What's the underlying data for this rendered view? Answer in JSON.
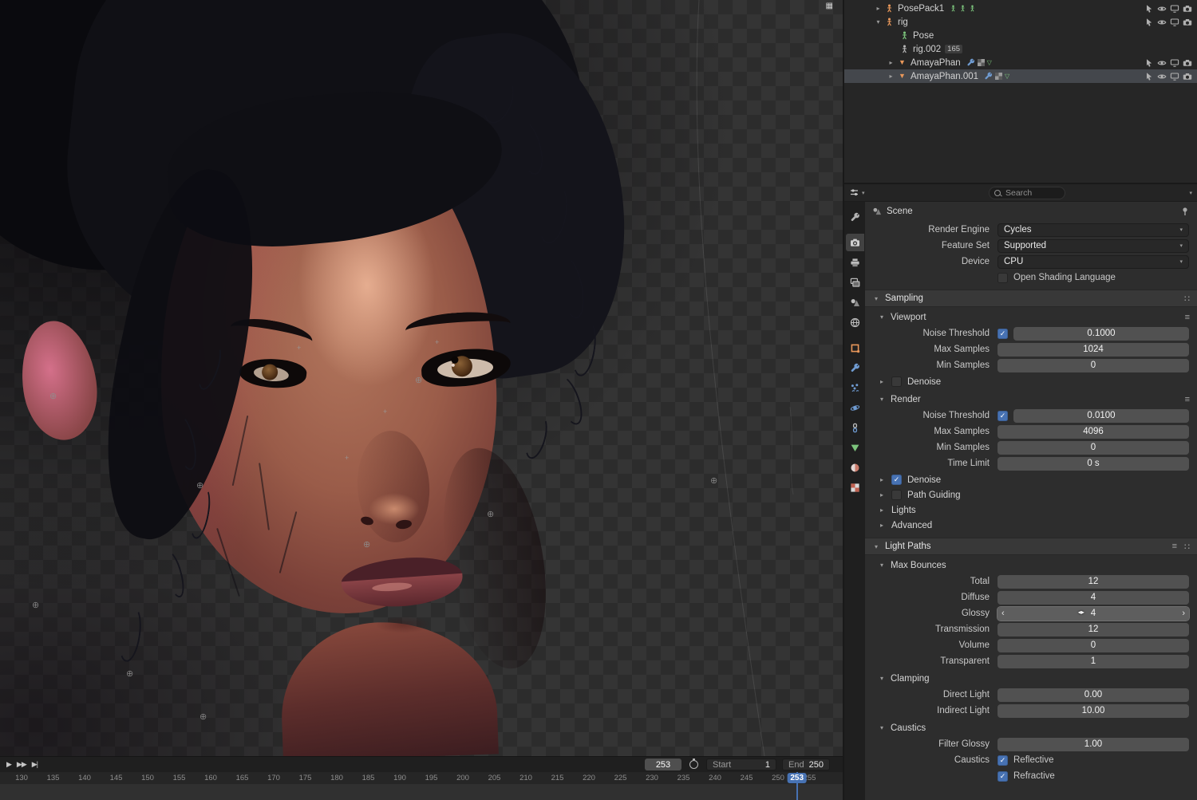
{
  "colors": {
    "accent": "#4772b3",
    "selected_row": "#44474c",
    "object_orange": "#e8975a",
    "data_green": "#7cc47c",
    "modifier_blue": "#6f9bd1"
  },
  "icons": {
    "collapsed": "▸",
    "expanded": "▾",
    "dropdown": "▾",
    "menu": "≡",
    "grid_dots": "∷",
    "check": "✓",
    "slider_left": "‹",
    "slider_right": "›",
    "corner_grid": "▦",
    "play": "▶",
    "next_keyframe": "▶▶",
    "jump_end": "▶|",
    "marker": "⊕",
    "marker_plus": "+",
    "mesh_triangle": "▼",
    "vertex_group": "▽",
    "drag_cursor": "◂▸"
  },
  "outliner": {
    "rows": [
      {
        "label": "PosePack1",
        "type": "armature",
        "badge": ""
      },
      {
        "label": "rig",
        "type": "armature",
        "badge": ""
      },
      {
        "label": "Pose",
        "type": "pose",
        "badge": ""
      },
      {
        "label": "rig.002",
        "type": "action",
        "badge": "165"
      },
      {
        "label": "AmayaPhan",
        "type": "mesh",
        "badge": ""
      },
      {
        "label": "AmayaPhan.001",
        "type": "mesh",
        "badge": "",
        "selected": true
      }
    ]
  },
  "properties": {
    "header": {
      "search_placeholder": "Search"
    },
    "breadcrumb": {
      "scene": "Scene"
    },
    "rows": {
      "render_engine": {
        "label": "Render Engine",
        "value": "Cycles"
      },
      "feature_set": {
        "label": "Feature Set",
        "value": "Supported"
      },
      "device": {
        "label": "Device",
        "value": "CPU"
      },
      "osl": {
        "label": "Open Shading Language",
        "checked": false
      }
    },
    "sampling": {
      "title": "Sampling",
      "viewport": {
        "title": "Viewport",
        "noise_threshold": {
          "label": "Noise Threshold",
          "value": "0.1000",
          "checked": true
        },
        "max_samples": {
          "label": "Max Samples",
          "value": "1024"
        },
        "min_samples": {
          "label": "Min Samples",
          "value": "0"
        },
        "denoise": {
          "label": "Denoise",
          "checked": false
        }
      },
      "render": {
        "title": "Render",
        "noise_threshold": {
          "label": "Noise Threshold",
          "value": "0.0100",
          "checked": true
        },
        "max_samples": {
          "label": "Max Samples",
          "value": "4096"
        },
        "min_samples": {
          "label": "Min Samples",
          "value": "0"
        },
        "time_limit": {
          "label": "Time Limit",
          "value": "0 s"
        },
        "denoise": {
          "label": "Denoise",
          "checked": true
        }
      },
      "path_guiding": {
        "label": "Path Guiding",
        "checked": false
      },
      "lights": {
        "label": "Lights"
      },
      "advanced": {
        "label": "Advanced"
      }
    },
    "light_paths": {
      "title": "Light Paths",
      "max_bounces": {
        "title": "Max Bounces",
        "total": {
          "label": "Total",
          "value": "12"
        },
        "diffuse": {
          "label": "Diffuse",
          "value": "4"
        },
        "glossy": {
          "label": "Glossy",
          "value": "4"
        },
        "transmission": {
          "label": "Transmission",
          "value": "12"
        },
        "volume": {
          "label": "Volume",
          "value": "0"
        },
        "transparent": {
          "label": "Transparent",
          "value": "1"
        }
      },
      "clamping": {
        "title": "Clamping",
        "direct_light": {
          "label": "Direct Light",
          "value": "0.00"
        },
        "indirect_light": {
          "label": "Indirect Light",
          "value": "10.00"
        }
      },
      "caustics": {
        "title": "Caustics",
        "filter_glossy": {
          "label": "Filter Glossy",
          "value": "1.00"
        },
        "caustics_label": "Caustics",
        "reflective": {
          "label": "Reflective",
          "checked": true
        },
        "refractive": {
          "label": "Refractive",
          "checked": true
        }
      }
    }
  },
  "timeline": {
    "current_frame": "253",
    "start": {
      "label": "Start",
      "value": "1"
    },
    "end": {
      "label": "End",
      "value": "250"
    },
    "ticks": [
      130,
      135,
      140,
      145,
      150,
      155,
      160,
      165,
      170,
      175,
      180,
      185,
      190,
      195,
      200,
      205,
      210,
      215,
      220,
      225,
      230,
      235,
      240,
      245,
      250,
      255
    ]
  }
}
